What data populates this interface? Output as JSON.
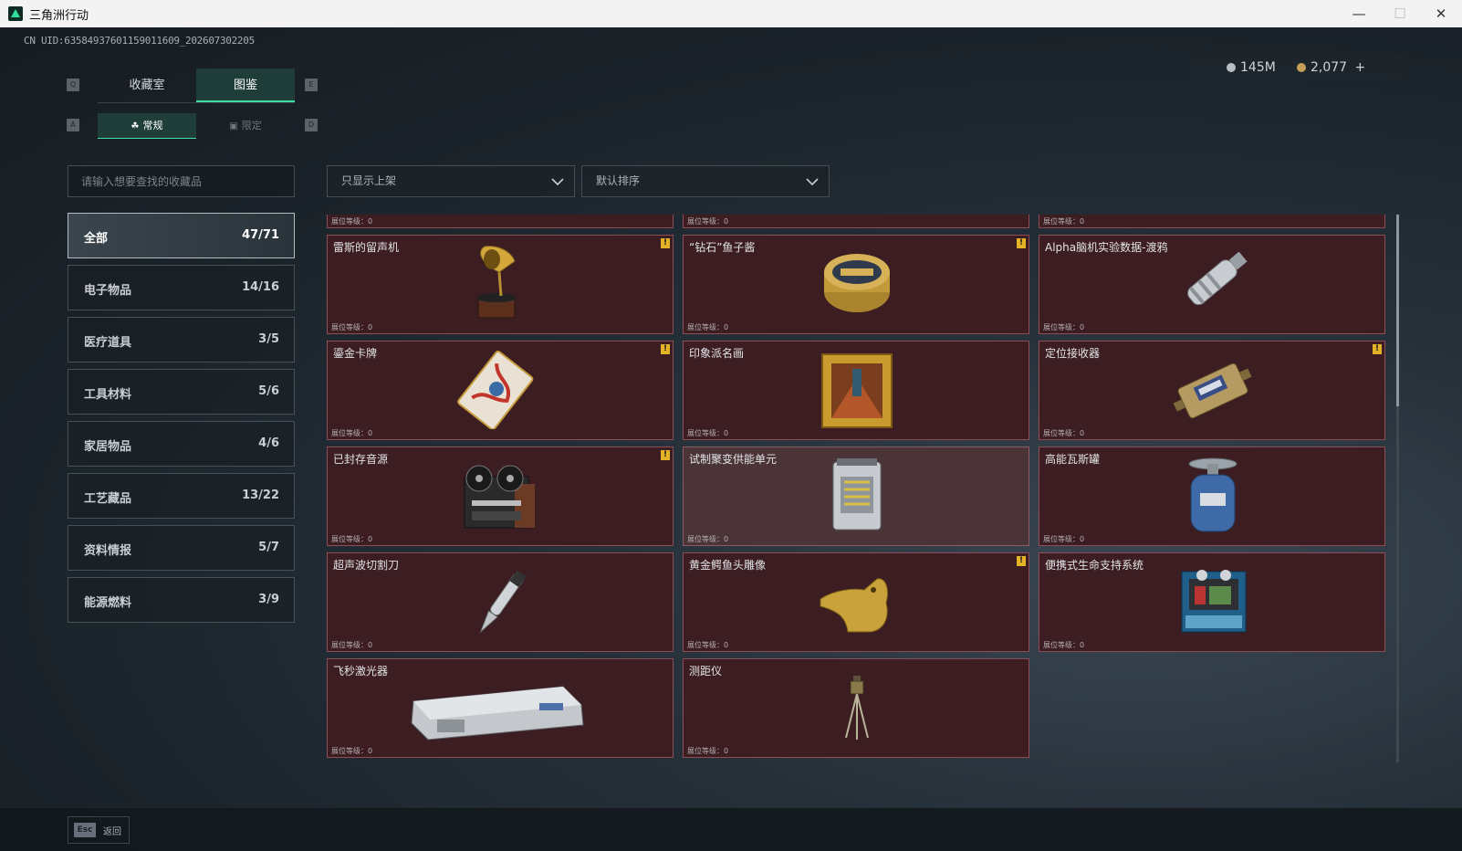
{
  "window": {
    "title": "三角洲行动",
    "min": "—",
    "max": "☐",
    "close": "✕"
  },
  "uid": "CN UID:6358493760115901160​9_202607302205",
  "currency": {
    "silver": "145M",
    "gold": "2,077",
    "plus": "+"
  },
  "keys": {
    "q": "Q",
    "e": "E",
    "a": "A",
    "d": "D"
  },
  "tabs": {
    "collection": "收藏室",
    "catalog": "图鉴"
  },
  "subtabs": {
    "normal": "常规",
    "limited": "限定"
  },
  "search": {
    "placeholder": "请输入想要查找的收藏品"
  },
  "filters": {
    "shelf": "只显示上架",
    "sort": "默认排序"
  },
  "categories": [
    {
      "name": "全部",
      "count": "47/71"
    },
    {
      "name": "电子物品",
      "count": "14/16"
    },
    {
      "name": "医疗道具",
      "count": "3/5"
    },
    {
      "name": "工具材料",
      "count": "5/6"
    },
    {
      "name": "家居物品",
      "count": "4/6"
    },
    {
      "name": "工艺藏品",
      "count": "13/22"
    },
    {
      "name": "资料情报",
      "count": "5/7"
    },
    {
      "name": "能源燃料",
      "count": "3/9"
    }
  ],
  "level_label": "展位等级：0",
  "badge_label": "!",
  "items": [
    {
      "name": "",
      "icon": "partial-item-icon",
      "badge": false
    },
    {
      "name": "",
      "icon": "partial-item-icon",
      "badge": false
    },
    {
      "name": "",
      "icon": "partial-item-icon",
      "badge": false
    },
    {
      "name": "雷斯的留声机",
      "icon": "gramophone-icon",
      "badge": true
    },
    {
      "name": "“钻石”鱼子酱",
      "icon": "caviar-tin-icon",
      "badge": true
    },
    {
      "name": "Alpha脑机实验数据-渡鸦",
      "icon": "data-canister-icon",
      "badge": false
    },
    {
      "name": "鎏金卡牌",
      "icon": "gilded-card-icon",
      "badge": true
    },
    {
      "name": "印象派名画",
      "icon": "framed-painting-icon",
      "badge": false
    },
    {
      "name": "定位接收器",
      "icon": "locator-receiver-icon",
      "badge": true
    },
    {
      "name": "已封存音源",
      "icon": "reel-recorder-icon",
      "badge": true
    },
    {
      "name": "试制聚变供能单元",
      "icon": "fusion-cell-icon",
      "badge": false
    },
    {
      "name": "高能瓦斯罐",
      "icon": "gas-canister-icon",
      "badge": false
    },
    {
      "name": "超声波切割刀",
      "icon": "ultrasonic-knife-icon",
      "badge": false
    },
    {
      "name": "黄金鳄鱼头雕像",
      "icon": "gold-crocodile-icon",
      "badge": true
    },
    {
      "name": "便携式生命支持系统",
      "icon": "life-support-icon",
      "badge": false
    },
    {
      "name": "飞秒激光器",
      "icon": "femtosecond-laser-icon",
      "badge": false
    },
    {
      "name": "测距仪",
      "icon": "rangefinder-tripod-icon",
      "badge": false
    }
  ],
  "footer": {
    "esc": "Esc",
    "back": "返回"
  }
}
